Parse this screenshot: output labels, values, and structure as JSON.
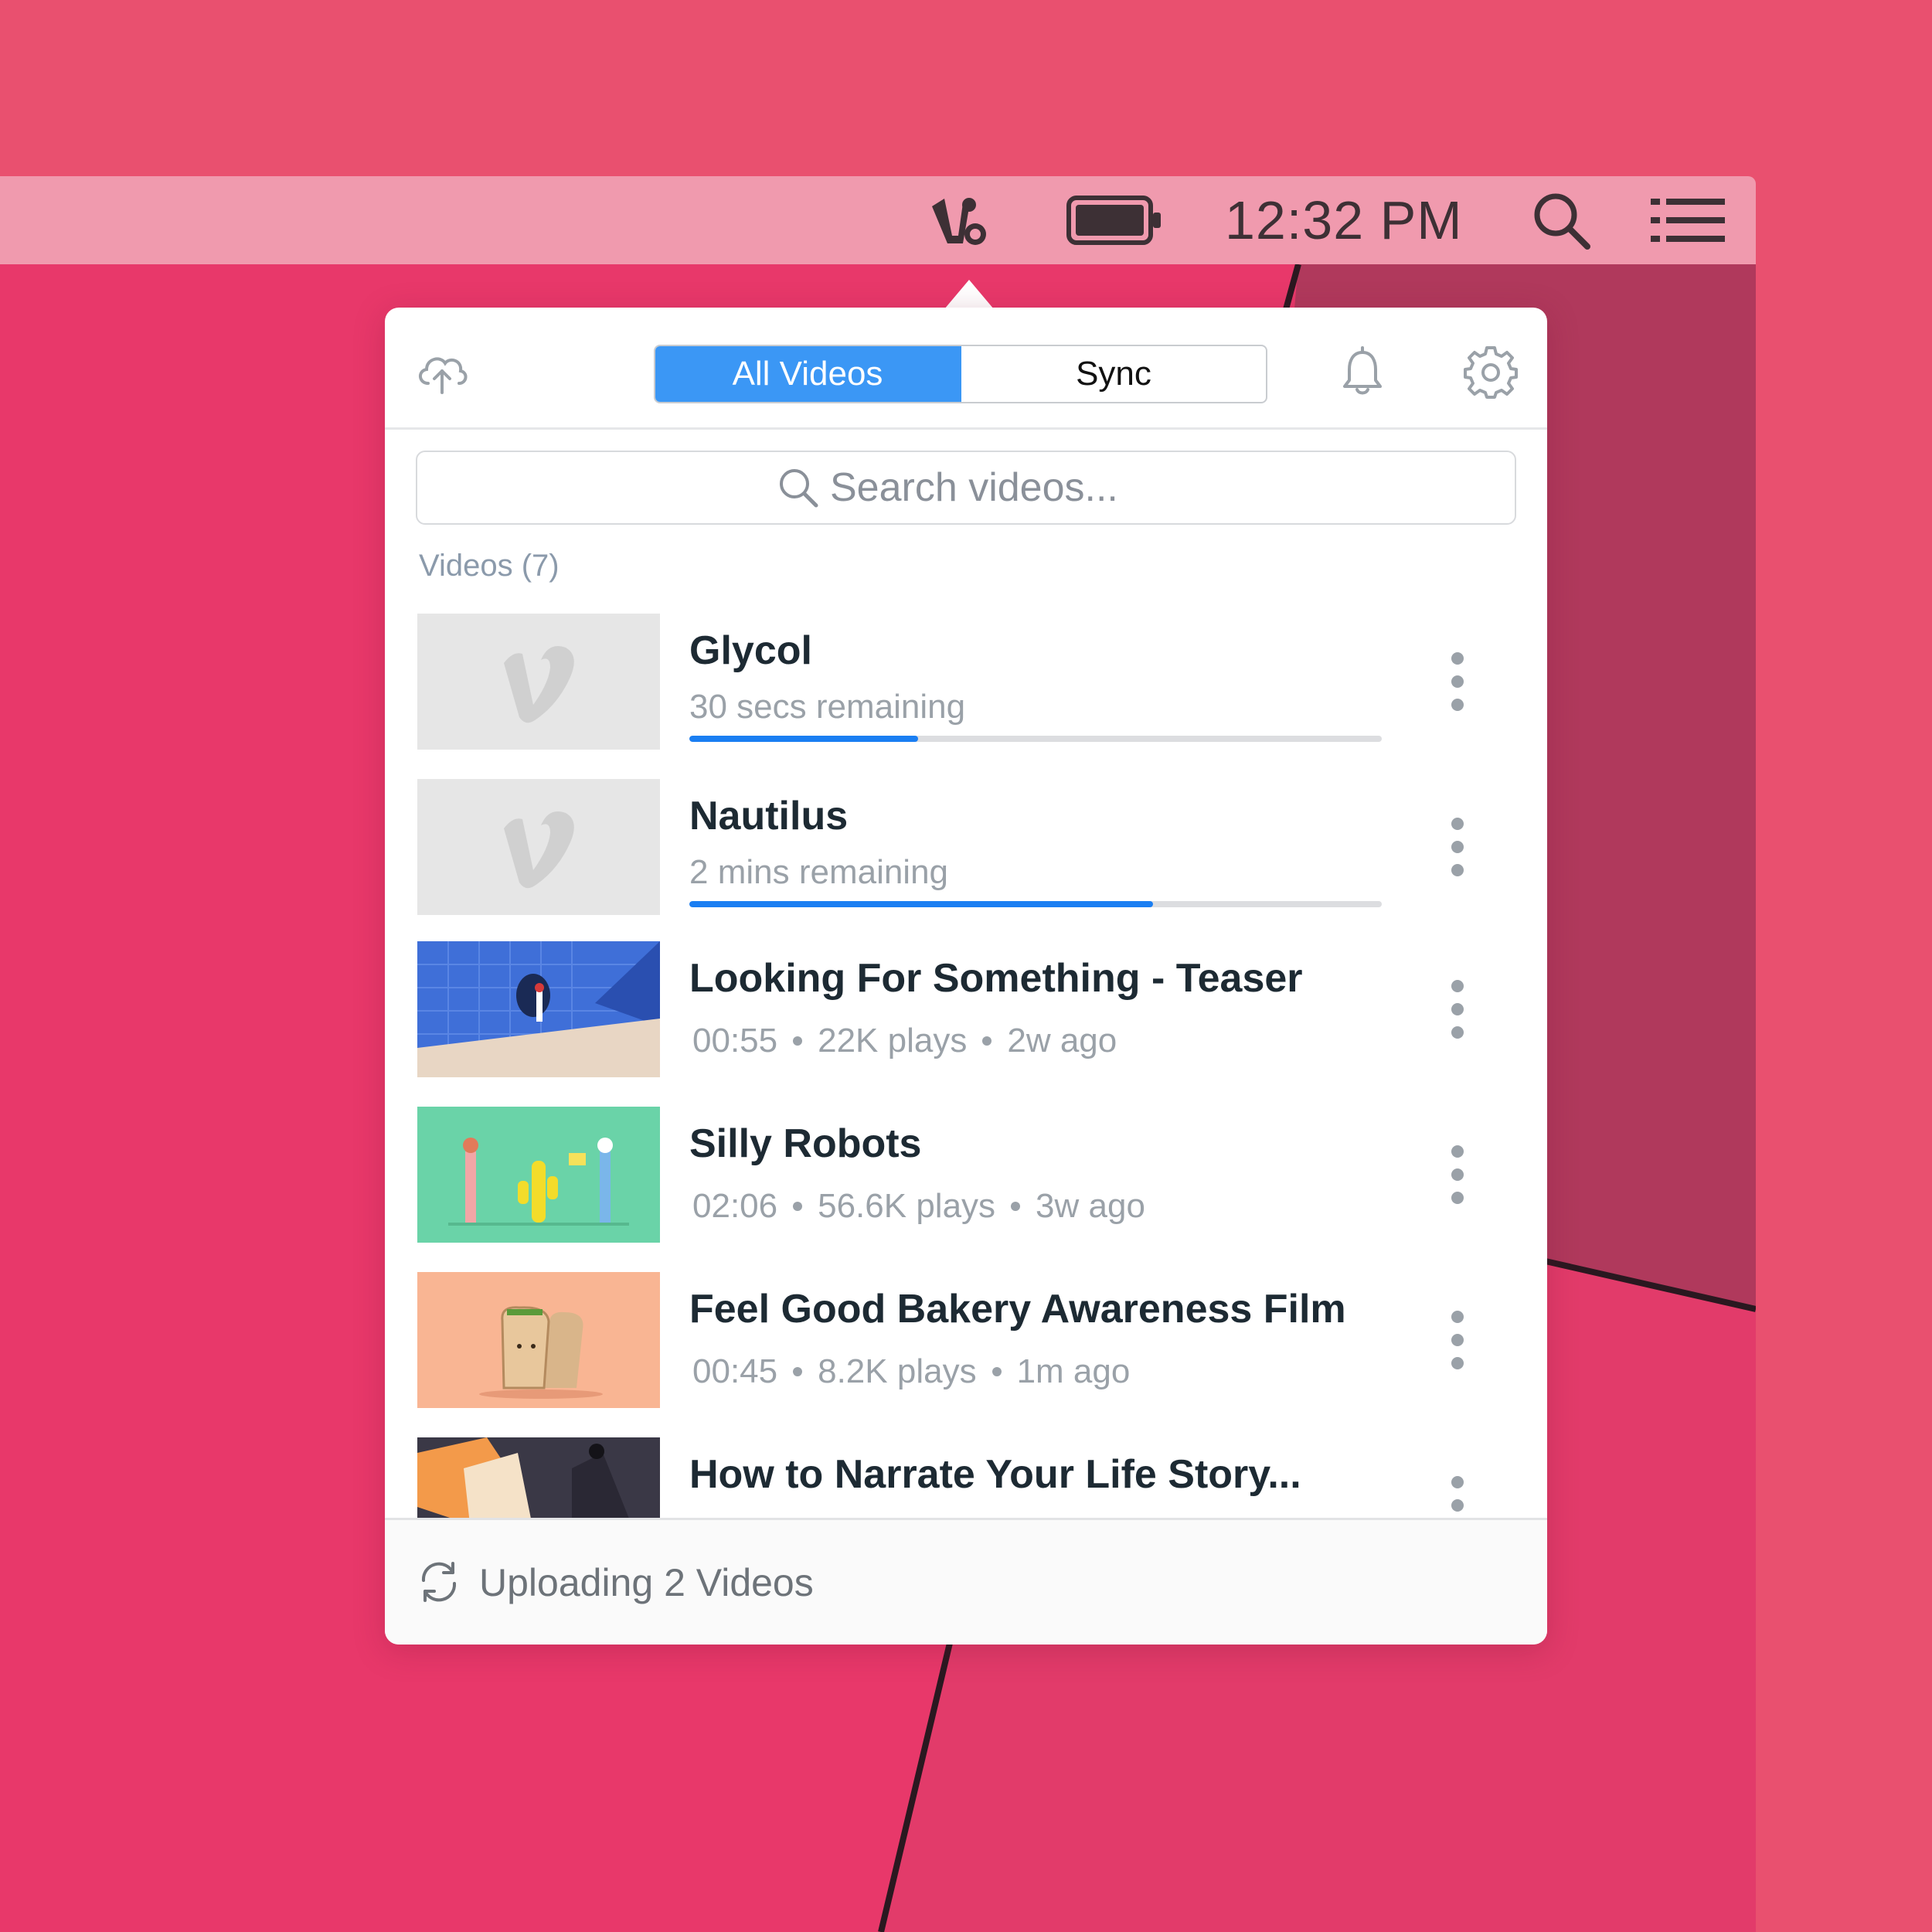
{
  "menubar": {
    "clock": "12:32 PM",
    "icons": [
      "vimeo-upload-icon",
      "battery-icon",
      "search-icon",
      "list-icon"
    ]
  },
  "toolbar": {
    "upload_icon": "cloud-upload-icon",
    "tabs": [
      {
        "label": "All Videos",
        "active": true
      },
      {
        "label": "Sync",
        "active": false
      }
    ],
    "notifications_icon": "bell-icon",
    "settings_icon": "gear-icon"
  },
  "search": {
    "placeholder": "Search videos..."
  },
  "section": {
    "label": "Videos (7)"
  },
  "videos": [
    {
      "title": "Glycol",
      "status": "30 secs remaining",
      "progress": 0.33,
      "thumbnail": "vimeo-placeholder"
    },
    {
      "title": "Nautilus",
      "status": "2 mins remaining",
      "progress": 0.67,
      "thumbnail": "vimeo-placeholder"
    },
    {
      "title": "Looking For Something - Teaser",
      "duration": "00:55",
      "plays": "22K plays",
      "age": "2w ago",
      "thumbnail": "blue-figure"
    },
    {
      "title": "Silly Robots",
      "duration": "02:06",
      "plays": "56.6K plays",
      "age": "3w ago",
      "thumbnail": "green-robots"
    },
    {
      "title": "Feel Good Bakery Awareness Film",
      "duration": "00:45",
      "plays": "8.2K plays",
      "age": "1m ago",
      "thumbnail": "peach-bread"
    },
    {
      "title": "How to Narrate Your Life Story...",
      "thumbnail": "dark-illustration"
    }
  ],
  "footer": {
    "status": "Uploading 2 Videos",
    "icon": "sync-icon"
  },
  "colors": {
    "accent": "#3b97f5",
    "progress": "#1a7ef2",
    "background": "#e9506f",
    "menubar": "#f09aae"
  }
}
